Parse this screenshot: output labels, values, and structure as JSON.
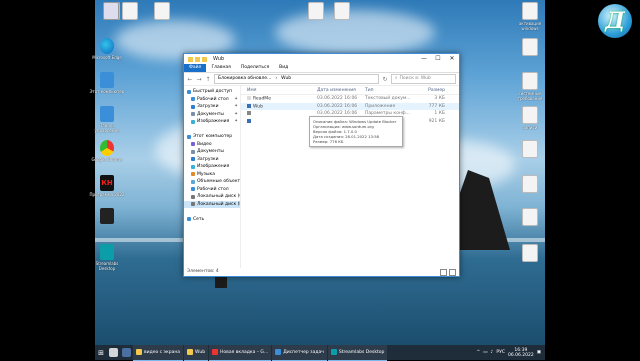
{
  "desktop": {
    "left_icons": [
      {
        "label": "",
        "icon": "file-icon"
      },
      {
        "label": "",
        "icon": "file-icon"
      },
      {
        "label": "",
        "icon": "file-icon"
      },
      {
        "label": "Microsoft Edge",
        "icon": "edge-icon"
      },
      {
        "label": "Этот компьютер",
        "icon": "computer-icon"
      },
      {
        "label": "Панель управления",
        "icon": "control-panel-icon"
      },
      {
        "label": "Google Chrome",
        "icon": "chrome-icon"
      },
      {
        "label": "Программа 2022",
        "icon": "kh-icon"
      },
      {
        "label": "",
        "icon": "app-icon"
      },
      {
        "label": "Streamlabs Desktop",
        "icon": "streamlabs-icon"
      }
    ],
    "right_icons": [
      {
        "label": "активация windows",
        "icon": "file-icon"
      },
      {
        "label": "",
        "icon": "file-icon"
      },
      {
        "label": "системные требования",
        "icon": "file-icon"
      },
      {
        "label": "записи",
        "icon": "file-icon"
      },
      {
        "label": "",
        "icon": "file-icon"
      },
      {
        "label": "",
        "icon": "file-icon"
      },
      {
        "label": "",
        "icon": "file-icon"
      },
      {
        "label": "",
        "icon": "file-icon"
      }
    ],
    "bin_label": ""
  },
  "explorer": {
    "title": "Wub",
    "tabs": [
      "Файл",
      "Главная",
      "Поделиться",
      "Вид"
    ],
    "path": [
      "Блокировка обновле...",
      "Wub"
    ],
    "search_placeholder": "Поиск в: Wub",
    "nav": [
      {
        "label": "Быстрый доступ",
        "level": 0,
        "color": "#3a8fd8",
        "pin": false
      },
      {
        "label": "Рабочий стол",
        "level": 1,
        "color": "#3a8fd8",
        "pin": true
      },
      {
        "label": "Загрузки",
        "level": 1,
        "color": "#2a7fd0",
        "pin": true
      },
      {
        "label": "Документы",
        "level": 1,
        "color": "#7a8fa8",
        "pin": true
      },
      {
        "label": "Изображения",
        "level": 1,
        "color": "#3ab0d8",
        "pin": true
      },
      {
        "label": "",
        "level": 0,
        "color": "#fff",
        "pin": false
      },
      {
        "label": "Этот компьютер",
        "level": 0,
        "color": "#3a8fd8",
        "pin": false
      },
      {
        "label": "Видео",
        "level": 1,
        "color": "#7a5fd8",
        "pin": false
      },
      {
        "label": "Документы",
        "level": 1,
        "color": "#7a8fa8",
        "pin": false
      },
      {
        "label": "Загрузки",
        "level": 1,
        "color": "#2a7fd0",
        "pin": false
      },
      {
        "label": "Изображения",
        "level": 1,
        "color": "#3ab0d8",
        "pin": false
      },
      {
        "label": "Музыка",
        "level": 1,
        "color": "#e08a2a",
        "pin": false
      },
      {
        "label": "Объемные объект",
        "level": 1,
        "color": "#5aaad8",
        "pin": false
      },
      {
        "label": "Рабочий стол",
        "level": 1,
        "color": "#3a8fd8",
        "pin": false
      },
      {
        "label": "Локальный диск (C",
        "level": 1,
        "color": "#777",
        "pin": false
      },
      {
        "label": "Локальный диск (D",
        "level": 1,
        "color": "#777",
        "pin": false
      },
      {
        "label": "",
        "level": 0,
        "color": "#fff",
        "pin": false
      },
      {
        "label": "Сеть",
        "level": 0,
        "color": "#3a8fd8",
        "pin": false
      }
    ],
    "columns": {
      "name": "Имя",
      "date": "Дата изменения",
      "type": "Тип",
      "size": "Размер"
    },
    "files": [
      {
        "name": "ReadMe",
        "date": "03.06.2022 16:06",
        "type": "Текстовый докум...",
        "size": "3 КБ",
        "color": "#ddd"
      },
      {
        "name": "Wub",
        "date": "03.06.2022 16:06",
        "type": "Приложение",
        "size": "777 КБ",
        "color": "#3a6fb8"
      },
      {
        "name": "",
        "date": "03.06.2022 16:06",
        "type": "Параметры конф...",
        "size": "1 КБ",
        "color": "#888"
      },
      {
        "name": "",
        "date": "03.06.2022 16:06",
        "type": "Приложение",
        "size": "921 КБ",
        "color": "#3a6fb8"
      }
    ],
    "tooltip": [
      "Описание файла: Windows Update Blocker",
      "Организация: www.sordum.org",
      "Версия файла: 1.7.0.0",
      "Дата создания: 28.01.2022 13:58",
      "Размер: 776 КБ"
    ],
    "status": "Элементов: 4"
  },
  "taskbar": {
    "apps": [
      {
        "label": "видео с экрана",
        "color": "#f2c94c"
      },
      {
        "label": "Wub",
        "color": "#f2c94c"
      },
      {
        "label": "Новая вкладка – G...",
        "color": "#e33"
      },
      {
        "label": "Диспетчер задач",
        "color": "#3a8fd8"
      },
      {
        "label": "Streamlabs Desktop",
        "color": "#0b9ea8"
      }
    ],
    "lang": "РУС",
    "time": "16:39",
    "date": "06.06.2022"
  },
  "logo": {
    "letter": "Д"
  }
}
